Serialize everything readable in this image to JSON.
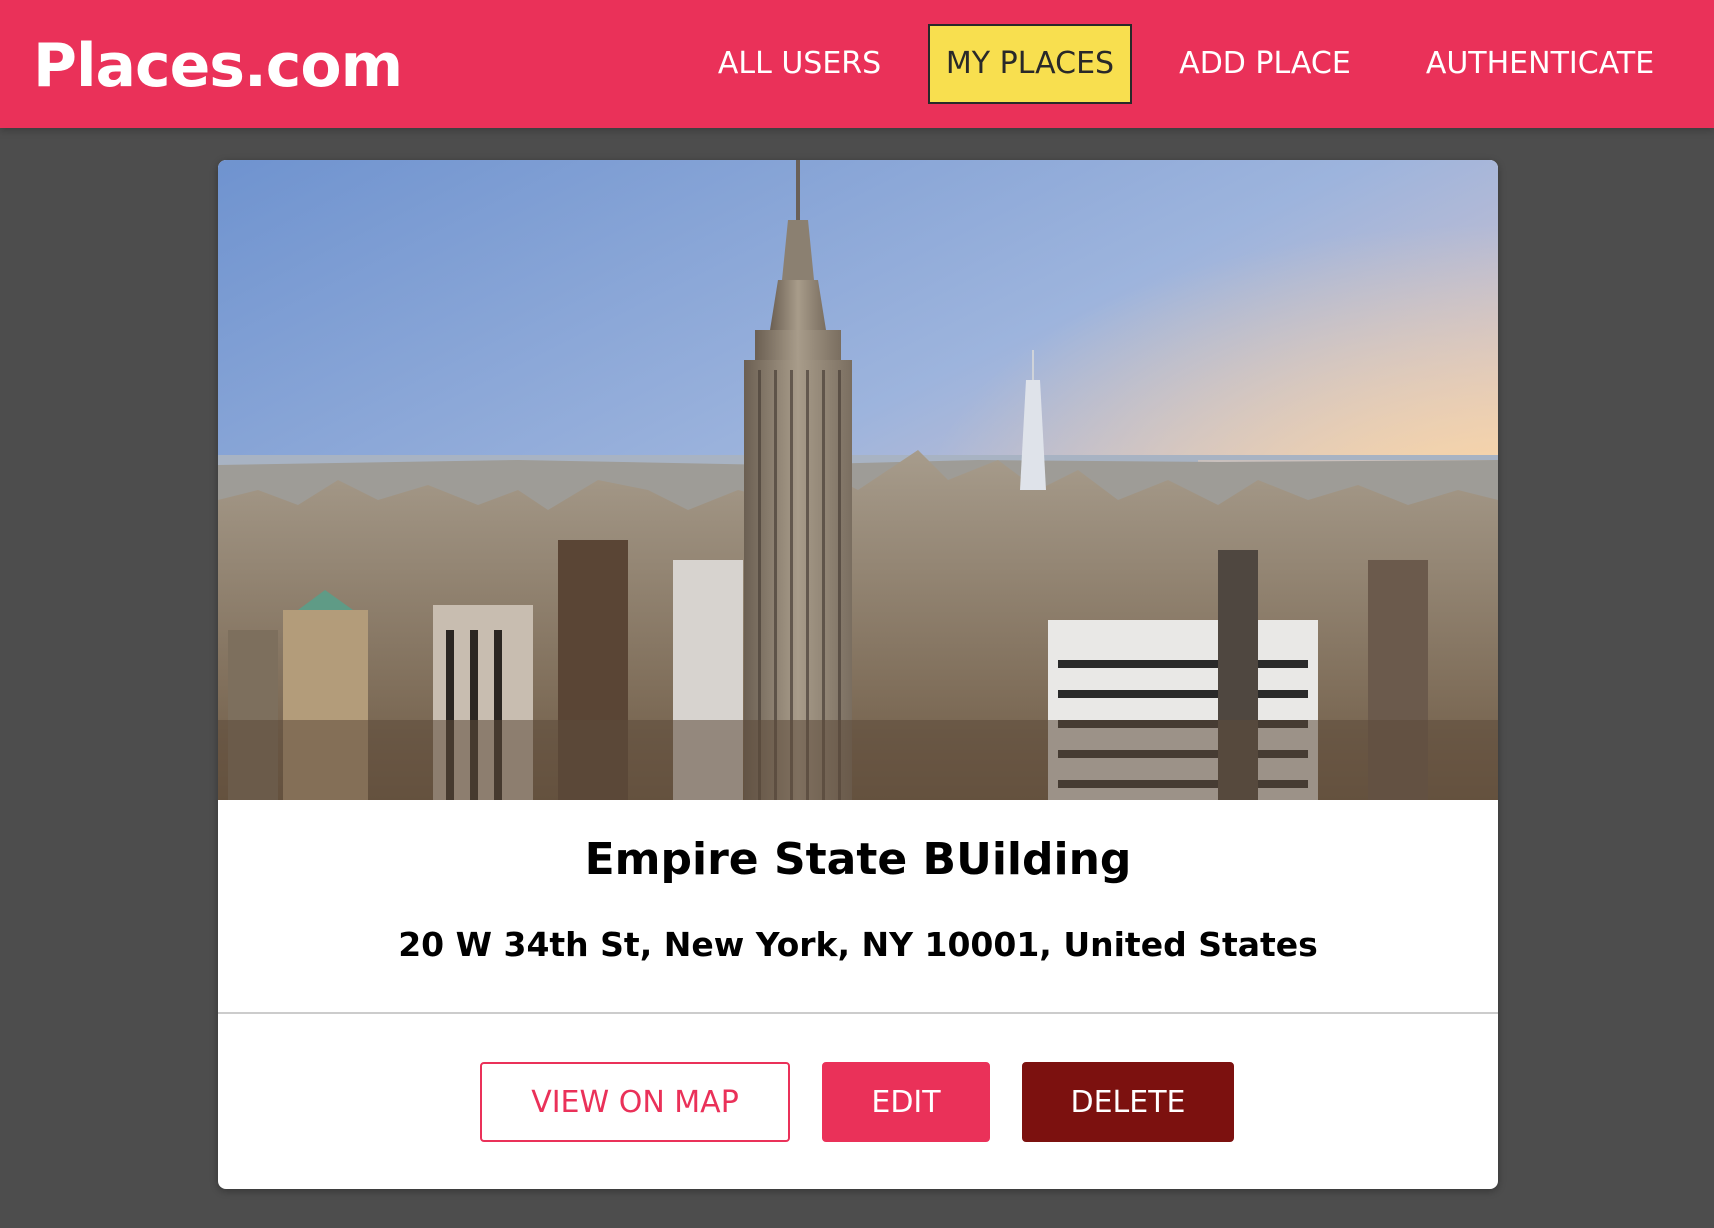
{
  "header": {
    "logo": "Places.com",
    "nav": [
      {
        "label": "ALL USERS",
        "active": false
      },
      {
        "label": "MY PLACES",
        "active": true
      },
      {
        "label": "ADD PLACE",
        "active": false
      },
      {
        "label": "AUTHENTICATE",
        "active": false
      }
    ]
  },
  "place": {
    "title": "Empire State BUilding",
    "address": "20 W 34th St, New York, NY 10001, United States",
    "image_subject": "new-york-skyline-empire-state-building"
  },
  "actions": {
    "view_on_map": "VIEW ON MAP",
    "edit": "EDIT",
    "delete": "DELETE"
  },
  "colors": {
    "brand": "#ea3159",
    "active_nav": "#f8df4f",
    "delete": "#7c110f",
    "background": "#4d4d4d"
  }
}
